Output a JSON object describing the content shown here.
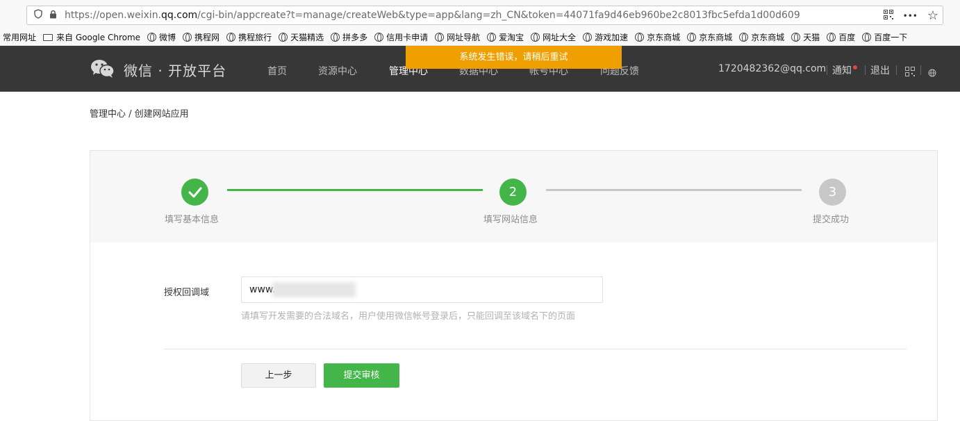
{
  "browser": {
    "url_prefix": "https://open.weixin.",
    "url_domain": "qq.com",
    "url_suffix": "/cgi-bin/appcreate?t=manage/createWeb&type=app&lang=zh_CN&token=44071fa9d46eb960be2c8013fbc5efda1d00d609",
    "more_label": "•••",
    "star_label": "☆"
  },
  "bookmarks": [
    "常用网址",
    "来自 Google Chrome",
    "微博",
    "携程网",
    "携程旅行",
    "天猫精选",
    "拼多多",
    "信用卡申请",
    "网址导航",
    "爱淘宝",
    "网址大全",
    "游戏加速",
    "京东商城",
    "京东商城",
    "京东商城",
    "天猫",
    "百度",
    "百度一下"
  ],
  "nav": {
    "logo_text": "微信 · 开放平台",
    "items": [
      "首页",
      "资源中心",
      "管理中心",
      "数据中心",
      "帐号中心",
      "问题反馈"
    ],
    "email": "1720482362@qq.com",
    "notice": "通知",
    "logout": "退出"
  },
  "toast": "系统发生错误，请稍后重试",
  "breadcrumb": "管理中心 / 创建网站应用",
  "steps": [
    {
      "number": "✓",
      "label": "填写基本信息",
      "status": "done"
    },
    {
      "number": "2",
      "label": "填写网站信息",
      "status": "current"
    },
    {
      "number": "3",
      "label": "提交成功",
      "status": "pending"
    }
  ],
  "form": {
    "label": "授权回调域",
    "value": "www.",
    "hint": "请填写开发需要的合法域名，用户使用微信帐号登录后，只能回调至该域名下的页面",
    "prev_button": "上一步",
    "submit_button": "提交审核"
  },
  "colors": {
    "green": "#44b549",
    "gray_step": "#c7c7c7",
    "toast": "#ef9f00",
    "nav_bg": "#373737"
  }
}
